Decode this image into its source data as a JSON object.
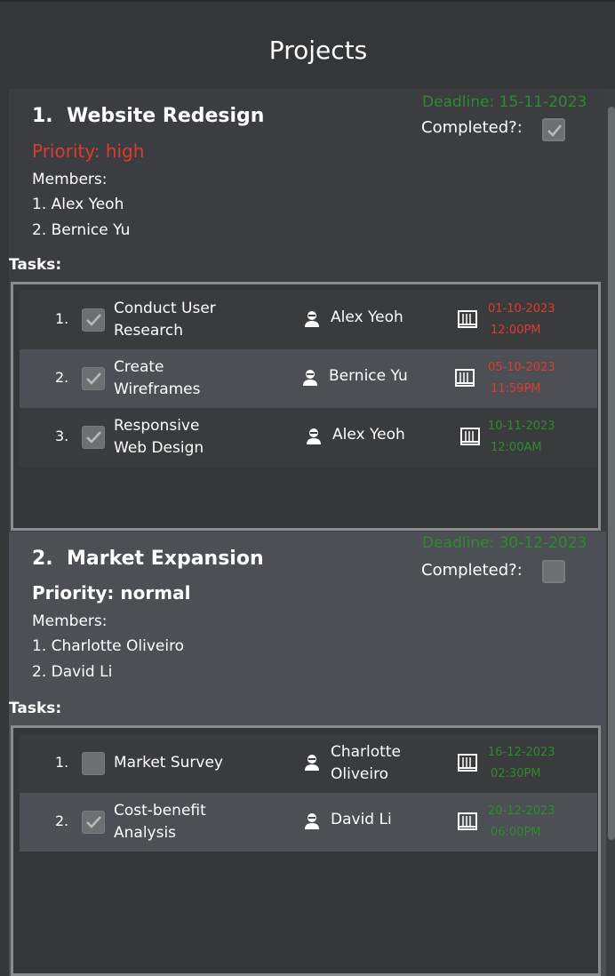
{
  "page": {
    "title": "Projects"
  },
  "colors": {
    "red": "#e03a2e",
    "green": "#2e8b2e",
    "white": "#ffffff"
  },
  "projects": [
    {
      "index": "1.",
      "name": "Website Redesign",
      "priority": "Priority: high",
      "priority_color": "#e03a2e",
      "members_label": "Members:",
      "members": [
        "1. Alex Yeoh",
        "2. Bernice Yu"
      ],
      "deadline": "Deadline: 15-11-2023",
      "completed_label": "Completed?:",
      "completed": true,
      "tasks_label": "Tasks:",
      "tasks": [
        {
          "index": "1.",
          "done": true,
          "name_lines": [
            "Conduct User",
            "Research"
          ],
          "assignee": "Alex Yeoh",
          "due_date": "01-10-2023",
          "due_time": "12:00PM",
          "due_color": "#e03a2e"
        },
        {
          "index": "2.",
          "done": true,
          "name_lines": [
            "Create",
            "Wireframes"
          ],
          "assignee": "Bernice Yu",
          "due_date": "05-10-2023",
          "due_time": "11:59PM",
          "due_color": "#e03a2e"
        },
        {
          "index": "3.",
          "done": true,
          "name_lines": [
            "Responsive",
            "Web Design"
          ],
          "assignee": "Alex Yeoh",
          "due_date": "10-11-2023",
          "due_time": "12:00AM",
          "due_color": "#2e8b2e"
        }
      ]
    },
    {
      "index": "2.",
      "name": "Market Expansion",
      "priority": "Priority: normal",
      "priority_color": "#ffffff",
      "members_label": "Members:",
      "members": [
        "1. Charlotte Oliveiro",
        "2. David Li"
      ],
      "deadline": "Deadline: 30-12-2023",
      "completed_label": "Completed?:",
      "completed": false,
      "tasks_label": "Tasks:",
      "tasks": [
        {
          "index": "1.",
          "done": false,
          "name_lines": [
            "Market Survey"
          ],
          "assignee_lines": [
            "Charlotte",
            "Oliveiro"
          ],
          "due_date": "16-12-2023",
          "due_time": "02:30PM",
          "due_color": "#2e8b2e"
        },
        {
          "index": "2.",
          "done": true,
          "name_lines": [
            "Cost-benefit",
            "Analysis"
          ],
          "assignee": "David Li",
          "due_date": "20-12-2023",
          "due_time": "06:00PM",
          "due_color": "#2e8b2e"
        }
      ]
    }
  ]
}
